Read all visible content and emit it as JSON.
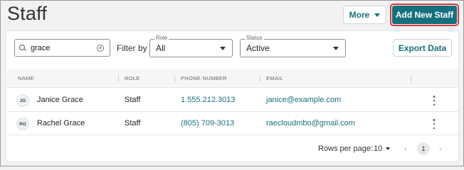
{
  "header": {
    "title": "Staff",
    "more_label": "More",
    "add_label": "Add New Staff"
  },
  "filters": {
    "search_value": "grace",
    "filter_by_label": "Filter by",
    "role_legend": "Role",
    "role_value": "All",
    "status_legend": "Status",
    "status_value": "Active",
    "export_label": "Export Data"
  },
  "table": {
    "columns": [
      "NAME",
      "ROLE",
      "PHONE NUMBER",
      "EMAIL"
    ],
    "rows": [
      {
        "initials": "JG",
        "name": "Janice Grace",
        "role": "Staff",
        "phone": "1.555.212.3013",
        "email": "janice@example.com"
      },
      {
        "initials": "RG",
        "name": "Rachel Grace",
        "role": "Staff",
        "phone": "(805) 709-3013",
        "email": "raecloudmbo@gmail.com"
      }
    ]
  },
  "pagination": {
    "rows_per_page_label": "Rows per page:",
    "rows_per_page_value": "10",
    "current_page": "1",
    "prev_symbol": "‹",
    "next_symbol": "›"
  },
  "colors": {
    "accent": "#15707e",
    "highlight_outline": "#e0353a"
  }
}
